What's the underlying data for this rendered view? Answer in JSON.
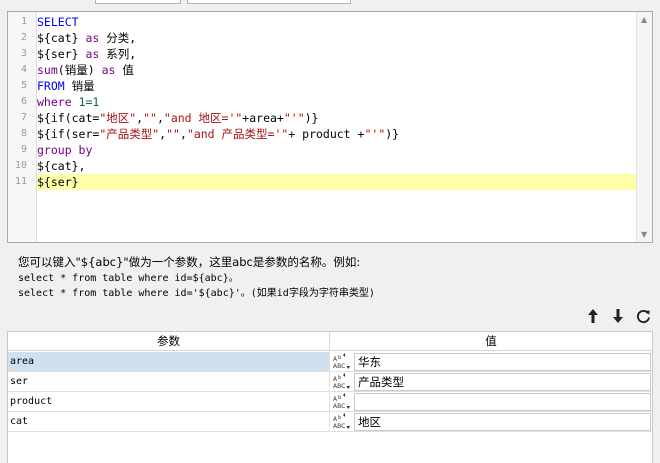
{
  "editor": {
    "lines": [
      {
        "num": "1",
        "tokens": [
          {
            "t": "SELECT",
            "k": "kw2"
          }
        ]
      },
      {
        "num": "2",
        "tokens": [
          {
            "t": "${cat}",
            "k": "id"
          },
          {
            "t": " ",
            "k": "id"
          },
          {
            "t": "as",
            "k": "kw"
          },
          {
            "t": " 分类,",
            "k": "id"
          }
        ]
      },
      {
        "num": "3",
        "tokens": [
          {
            "t": "${ser}",
            "k": "id"
          },
          {
            "t": " ",
            "k": "id"
          },
          {
            "t": "as",
            "k": "kw"
          },
          {
            "t": " 系列,",
            "k": "id"
          }
        ]
      },
      {
        "num": "4",
        "tokens": [
          {
            "t": "sum",
            "k": "kw"
          },
          {
            "t": "(销量) ",
            "k": "id"
          },
          {
            "t": "as",
            "k": "kw"
          },
          {
            "t": " 值",
            "k": "id"
          }
        ]
      },
      {
        "num": "5",
        "tokens": [
          {
            "t": "FROM",
            "k": "kw2"
          },
          {
            "t": " 销量",
            "k": "id"
          }
        ]
      },
      {
        "num": "6",
        "tokens": [
          {
            "t": "where",
            "k": "kw"
          },
          {
            "t": " ",
            "k": "id"
          },
          {
            "t": "1=1",
            "k": "num"
          }
        ]
      },
      {
        "num": "7",
        "tokens": [
          {
            "t": "${if(cat=",
            "k": "id"
          },
          {
            "t": "\"地区\"",
            "k": "str"
          },
          {
            "t": ",",
            "k": "id"
          },
          {
            "t": "\"\"",
            "k": "str"
          },
          {
            "t": ",",
            "k": "id"
          },
          {
            "t": "\"and 地区='\"",
            "k": "str"
          },
          {
            "t": "+area+",
            "k": "id"
          },
          {
            "t": "\"'\"",
            "k": "str"
          },
          {
            "t": ")}",
            "k": "id"
          }
        ]
      },
      {
        "num": "8",
        "tokens": [
          {
            "t": "${if(ser=",
            "k": "id"
          },
          {
            "t": "\"产品类型\"",
            "k": "str"
          },
          {
            "t": ",",
            "k": "id"
          },
          {
            "t": "\"\"",
            "k": "str"
          },
          {
            "t": ",",
            "k": "id"
          },
          {
            "t": "\"and 产品类型='\"",
            "k": "str"
          },
          {
            "t": "+ product +",
            "k": "id"
          },
          {
            "t": "\"'\"",
            "k": "str"
          },
          {
            "t": ")}",
            "k": "id"
          }
        ]
      },
      {
        "num": "9",
        "tokens": [
          {
            "t": "group by",
            "k": "kw"
          }
        ]
      },
      {
        "num": "10",
        "tokens": [
          {
            "t": "${cat},",
            "k": "id"
          }
        ]
      },
      {
        "num": "11",
        "tokens": [
          {
            "t": "${ser}",
            "k": "id"
          }
        ],
        "active": true
      }
    ]
  },
  "hint": {
    "main": "您可以键入\"${abc}\"做为一个参数，这里abc是参数的名称。例如:",
    "example1": "select * from table where id=${abc}。",
    "example2": "select * from table where id='${abc}'。(如果id字段为字符串类型)"
  },
  "toolbar": {
    "up_icon": "arrow-up-icon",
    "down_icon": "arrow-down-icon",
    "refresh_icon": "refresh-icon"
  },
  "params_table": {
    "header_param": "参数",
    "header_value": "值",
    "rows": [
      {
        "name": "area",
        "value": "华东",
        "selected": true
      },
      {
        "name": "ser",
        "value": "产品类型",
        "selected": false
      },
      {
        "name": "product",
        "value": "",
        "selected": false
      },
      {
        "name": "cat",
        "value": "地区",
        "selected": false
      }
    ]
  },
  "colors": {
    "keyword": "#770088",
    "keyword_blue": "#0000ff",
    "string": "#aa1111",
    "number": "#116644",
    "active_line": "#ffffa8",
    "selected_row": "#cfe0ef"
  }
}
